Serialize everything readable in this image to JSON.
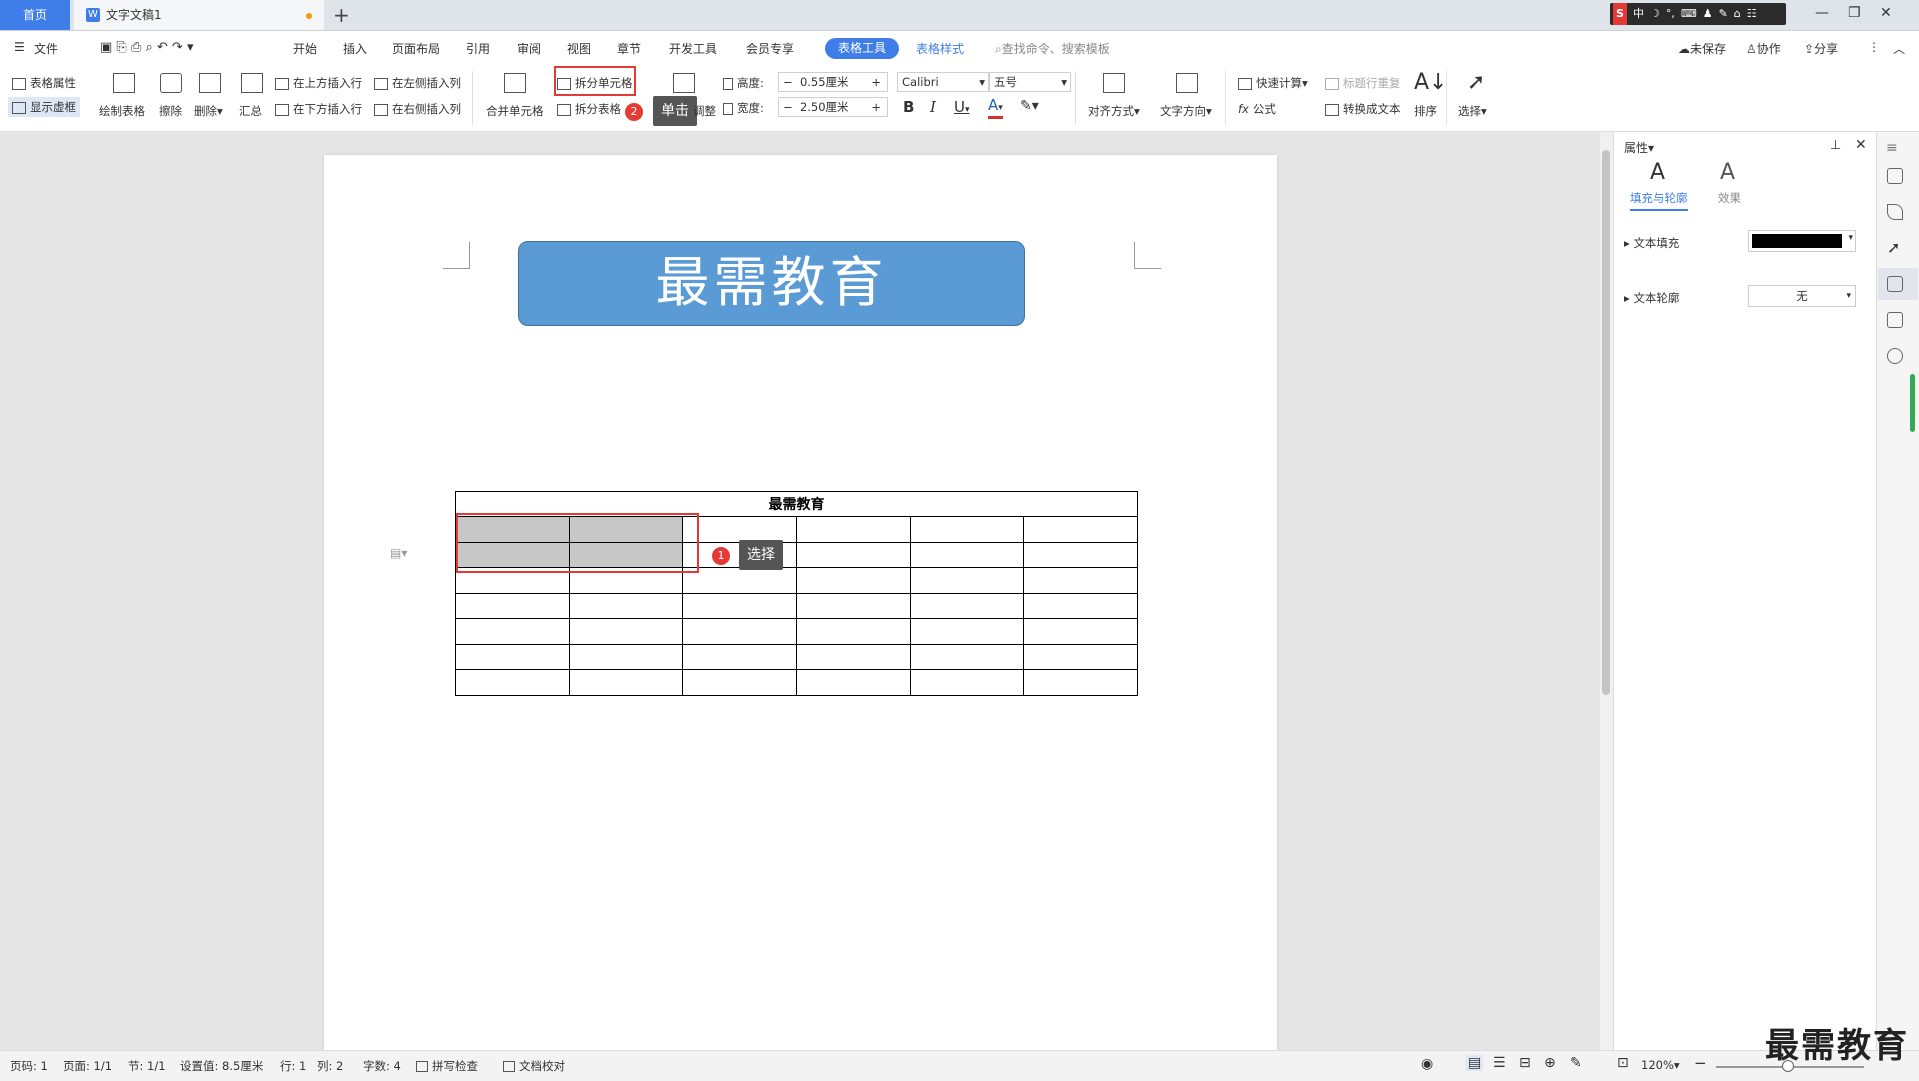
{
  "titlebar": {
    "home_tab": "首页",
    "doc_tab": "文字文稿1",
    "doc_icon": "W",
    "add_tab": "+",
    "ime": [
      "S",
      "中",
      "☽",
      "°,",
      "⌨",
      "♟",
      "✎",
      "⌂",
      "☷"
    ],
    "window_buttons": [
      "—",
      "❐",
      "✕"
    ]
  },
  "menu": {
    "file": "文件",
    "items": [
      "开始",
      "插入",
      "页面布局",
      "引用",
      "审阅",
      "视图",
      "章节",
      "开发工具",
      "会员专享"
    ],
    "active": "表格工具",
    "table_style": "表格样式",
    "search": "查找命令、搜索模板",
    "unsaved": "未保存",
    "collab": "协作",
    "share": "分享"
  },
  "ribbon": {
    "table_props": "表格属性",
    "show_gridlines": "显示虚框",
    "draw_table": "绘制表格",
    "erase": "擦除",
    "delete": "删除",
    "summary": "汇总",
    "insert_above": "在上方插入行",
    "insert_below": "在下方插入行",
    "insert_left": "在左侧插入列",
    "insert_right": "在右侧插入列",
    "merge_cells": "合并单元格",
    "split_cells": "拆分单元格",
    "split_table": "拆分表格",
    "auto_fit": "调整",
    "height_label": "高度:",
    "height_value": "0.55厘米",
    "width_label": "宽度:",
    "width_value": "2.50厘米",
    "font": "Calibri",
    "font_size": "五号",
    "bold": "B",
    "italic": "I",
    "underline": "U",
    "font_color": "A",
    "align": "对齐方式",
    "text_direction": "文字方向",
    "quick_calc": "快速计算",
    "repeat_header": "标题行重复",
    "formula": "公式",
    "to_text": "转换成文本",
    "sort": "排序",
    "select": "选择",
    "minus": "−",
    "plus": "+"
  },
  "callouts": {
    "step1_num": "1",
    "step1_text": "选择",
    "step2_num": "2",
    "step2_text": "单击"
  },
  "document": {
    "banner": "最需教育",
    "table_header": "最需教育",
    "rows": 7,
    "cols": 6
  },
  "panel": {
    "title": "属性",
    "tab_fill": "填充与轮廓",
    "tab_effect": "效果",
    "text_fill": "文本填充",
    "text_outline": "文本轮廓",
    "outline_value": "无",
    "fill_color": "#000000"
  },
  "status": {
    "page_num": "页码: 1",
    "pages": "页面: 1/1",
    "section": "节: 1/1",
    "setting": "设置值: 8.5厘米",
    "row": "行: 1",
    "col": "列: 2",
    "words": "字数: 4",
    "spellcheck": "拼写检查",
    "doc_check": "文档校对",
    "zoom": "120%"
  },
  "watermark": "最需教育",
  "colors": {
    "accent": "#3f7ee8",
    "banner": "#5b9bd5",
    "highlight": "#e53935",
    "selection": "#c8c8c8"
  }
}
